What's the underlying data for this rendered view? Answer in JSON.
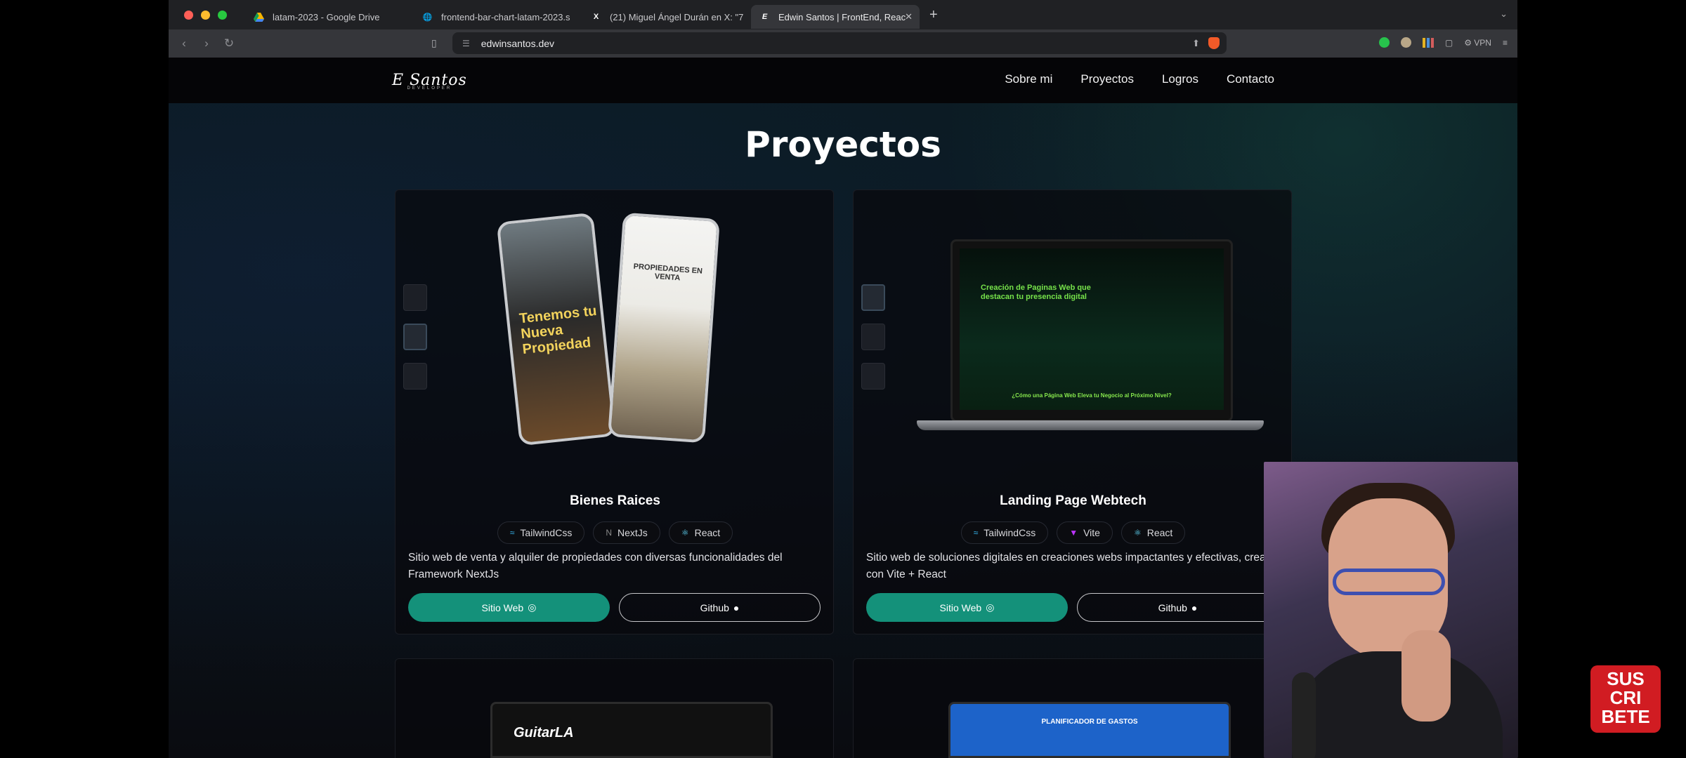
{
  "browser": {
    "tabs": [
      {
        "title": "latam-2023 - Google Drive",
        "icon": "drive-icon"
      },
      {
        "title": "frontend-bar-chart-latam-2023.s",
        "icon": "globe-icon"
      },
      {
        "title": "(21) Miguel Ángel Durán en X: \"7",
        "icon": "x-icon"
      },
      {
        "title": "Edwin Santos | FrontEnd, Reac",
        "icon": "e-icon",
        "active": true
      }
    ],
    "url": "edwinsantos.dev",
    "vpn_label": "VPN"
  },
  "site": {
    "logo": "E Santos",
    "logo_sub": "DEVELOPER",
    "nav": [
      "Sobre mi",
      "Proyectos",
      "Logros",
      "Contacto"
    ],
    "section_title": "Proyectos"
  },
  "projects": [
    {
      "title": "Bienes Raices",
      "tags": [
        "TailwindCss",
        "NextJs",
        "React"
      ],
      "description": "Sitio web de venta y alquiler de propiedades con diversas funcionalidades del Framework NextJs",
      "site_button": "Sitio Web",
      "github_button": "Github",
      "mockup_text_1": "Tenemos tu Nueva Propiedad",
      "mockup_text_2": "PROPIEDADES EN VENTA"
    },
    {
      "title": "Landing Page Webtech",
      "tags": [
        "TailwindCss",
        "Vite",
        "React"
      ],
      "description": "Sitio web de soluciones digitales en creaciones webs impactantes y efectivas, creado con Vite + React",
      "site_button": "Sitio Web",
      "github_button": "Github",
      "mockup_heading": "Creación de Paginas Web que destacan tu presencia digital",
      "mockup_footer": "¿Cómo una Página Web Eleva tu Negocio al Próximo Nivel?"
    },
    {
      "mockup_heading": "GuitarLA"
    },
    {
      "mockup_heading": "PLANIFICADOR DE GASTOS"
    }
  ],
  "overlay": {
    "subscribe": "SUS CRI BETE"
  },
  "colors": {
    "accent": "#14917a",
    "tab_bar": "#202124",
    "toolbar": "#35363a"
  }
}
